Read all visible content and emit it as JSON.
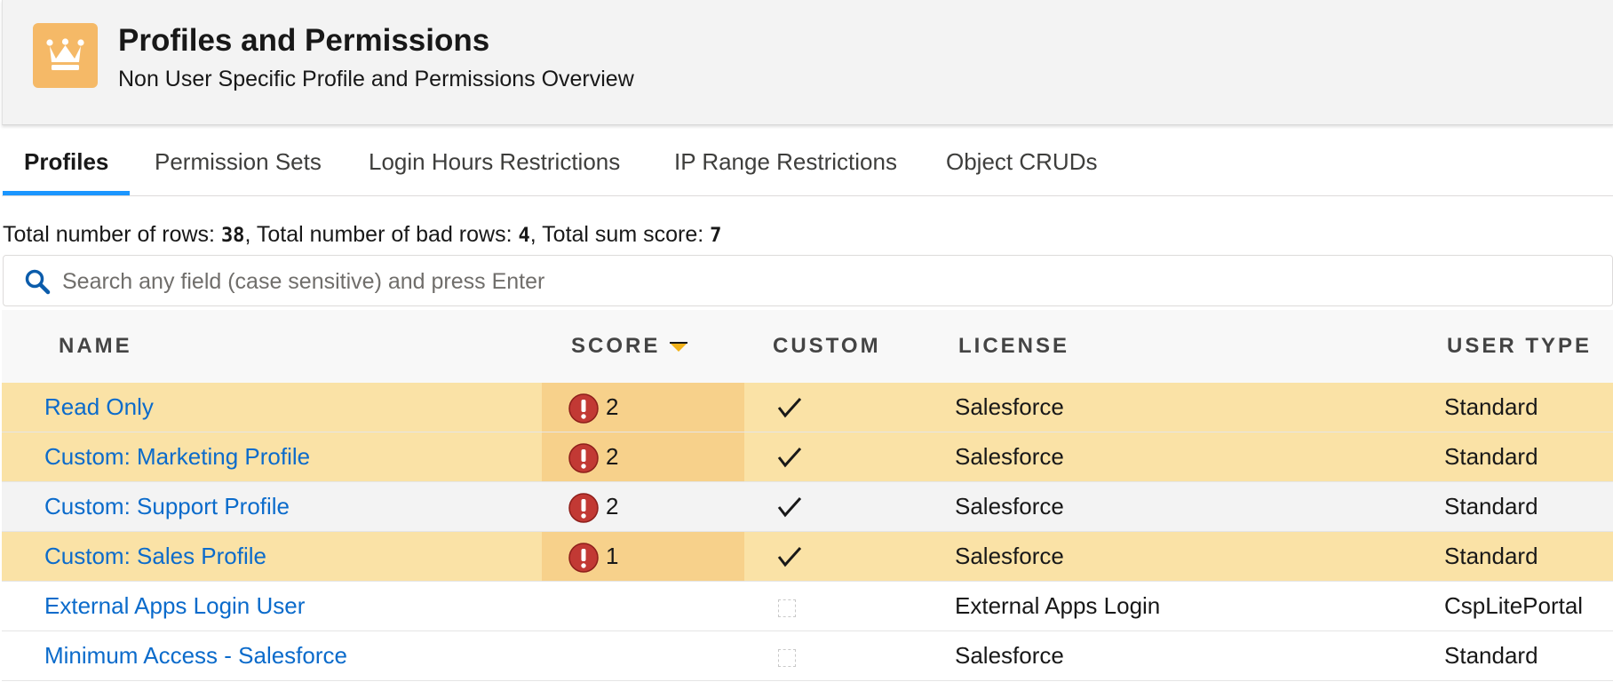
{
  "header": {
    "title": "Profiles and Permissions",
    "subtitle": "Non User Specific Profile and Permissions Overview",
    "icon": "crown-icon",
    "icon_color": "#f5b967"
  },
  "tabs": [
    {
      "label": "Profiles",
      "active": true
    },
    {
      "label": "Permission Sets",
      "active": false
    },
    {
      "label": "Login Hours Restrictions",
      "active": false
    },
    {
      "label": "IP Range Restrictions",
      "active": false
    },
    {
      "label": "Object CRUDs",
      "active": false
    }
  ],
  "summary": {
    "rows_label": "Total number of rows: ",
    "rows_value": "38",
    "bad_label": ", Total number of bad rows: ",
    "bad_value": "4",
    "score_label": ", Total sum score: ",
    "score_value": "7"
  },
  "search": {
    "placeholder": "Search any field (case sensitive) and press Enter",
    "value": ""
  },
  "table": {
    "columns": [
      "NAME",
      "SCORE",
      "CUSTOM",
      "LICENSE",
      "USER TYPE"
    ],
    "sort_column": "SCORE",
    "sort_icon": "sort-desc-icon",
    "rows": [
      {
        "name": "Read Only",
        "score": "2",
        "custom": true,
        "license": "Salesforce",
        "user_type": "Standard",
        "highlight": "warn"
      },
      {
        "name": "Custom: Marketing Profile",
        "score": "2",
        "custom": true,
        "license": "Salesforce",
        "user_type": "Standard",
        "highlight": "warn"
      },
      {
        "name": "Custom: Support Profile",
        "score": "2",
        "custom": true,
        "license": "Salesforce",
        "user_type": "Standard",
        "highlight": "grey"
      },
      {
        "name": "Custom: Sales Profile",
        "score": "1",
        "custom": true,
        "license": "Salesforce",
        "user_type": "Standard",
        "highlight": "warn"
      },
      {
        "name": "External Apps Login User",
        "score": "",
        "custom": false,
        "license": "External Apps Login",
        "user_type": "CspLitePortal",
        "highlight": "plain"
      },
      {
        "name": "Minimum Access - Salesforce",
        "score": "",
        "custom": false,
        "license": "Salesforce",
        "user_type": "Standard",
        "highlight": "plain"
      }
    ]
  },
  "colors": {
    "warn_row": "#fae2a6",
    "warn_score": "#f7d18b",
    "link": "#0b6bcb",
    "active_tab": "#1b96ff",
    "error_icon": "#c23934"
  }
}
